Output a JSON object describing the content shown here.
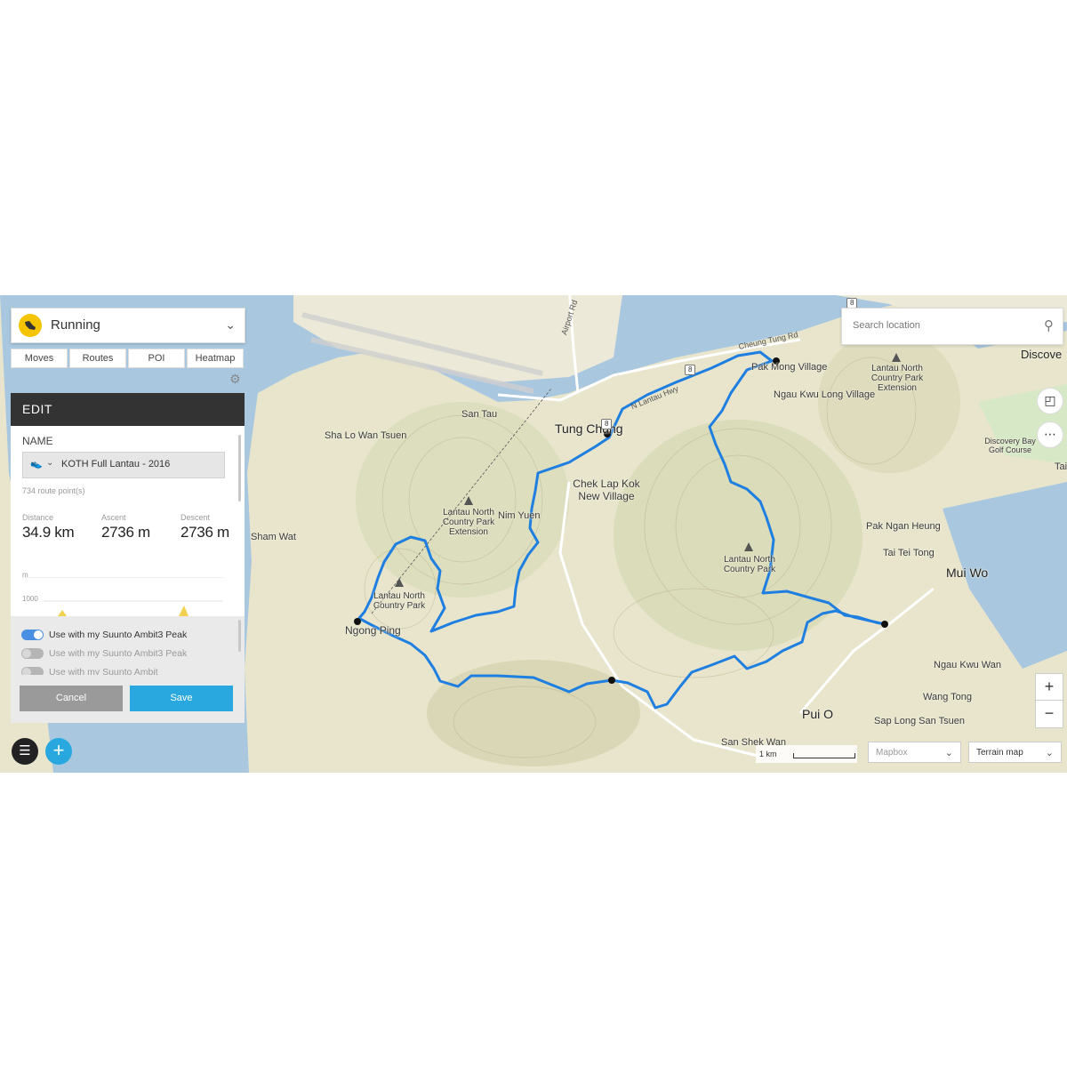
{
  "activity": {
    "label": "Running",
    "icon": "running-shoe-icon"
  },
  "tabs": [
    "Moves",
    "Routes",
    "POI",
    "Heatmap"
  ],
  "edit": {
    "header": "EDIT",
    "name_label": "NAME",
    "route_name": "KOTH Full Lantau - 2016",
    "route_points": "734  route point(s)",
    "stats": [
      {
        "label": "Distance",
        "value": "34.9 km"
      },
      {
        "label": "Ascent",
        "value": "2736 m"
      },
      {
        "label": "Descent",
        "value": "2736 m"
      }
    ],
    "chart_unit": "m",
    "chart_tick": "1000"
  },
  "devices": [
    {
      "label": "Use with my Suunto Ambit3 Peak",
      "enabled": true
    },
    {
      "label": "Use with my Suunto Ambit3 Peak",
      "enabled": false
    },
    {
      "label": "Use with my Suunto Ambit",
      "enabled": false
    }
  ],
  "buttons": {
    "cancel": "Cancel",
    "save": "Save"
  },
  "search": {
    "placeholder": "Search location"
  },
  "map": {
    "places": {
      "tung_chung": "Tung Chung",
      "mui_wo": "Mui Wo",
      "pui_o": "Pui O",
      "ngong_ping": "Ngong Ping",
      "san_tau": "San Tau",
      "sha_lo_wan_tsuen": "Sha Lo Wan Tsuen",
      "sham_wat": "Sham Wat",
      "nim_yuen": "Nim Yuen",
      "chek_lap_kok_new_village": "Chek Lap Kok New Village",
      "pak_mong_village": "Pak Mong Village",
      "ngau_kwu_long_village": "Ngau Kwu Long Village",
      "pak_ngan_heung": "Pak Ngan Heung",
      "tai_tei_tong": "Tai Tei Tong",
      "ngau_kwu_wan": "Ngau Kwu Wan",
      "wang_tong": "Wang Tong",
      "sap_long_san_tsuen": "Sap Long San Tsuen",
      "san_shek_wan": "San Shek Wan",
      "discovery": "Discove",
      "discovery_bay_golf": "Discovery Bay Golf Course",
      "tai": "Tai",
      "park_north_ext": "Lantau North Country Park Extension",
      "park_north": "Lantau North Country Park",
      "park_ngong_ping": "Lantau North Country Park",
      "park_ne_ext": "Lantau North Country Park Extension"
    },
    "roads": {
      "airport_rd": "Airport Rd",
      "cheung_tung_rd": "Cheung Tung Rd",
      "n_lantau_hwy": "N Lantau Hwy",
      "shield_8": "8"
    },
    "scale_label": "1 km",
    "provider": "Mapbox",
    "style": "Terrain map",
    "route_color": "#1f7fe0"
  }
}
